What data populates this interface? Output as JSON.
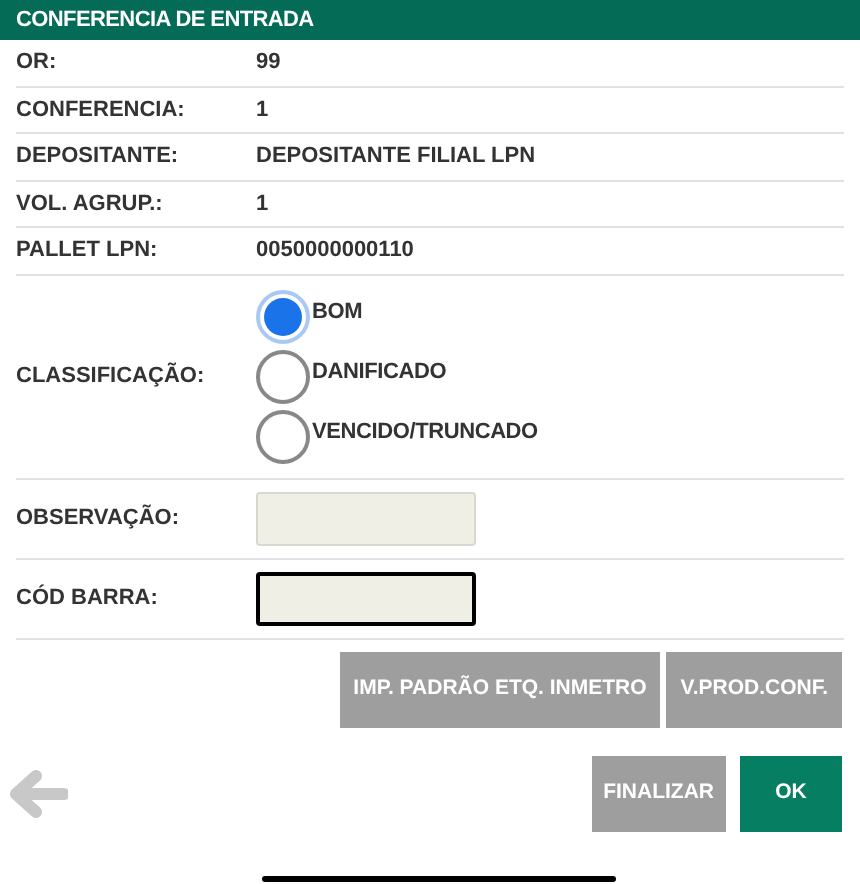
{
  "header": {
    "title": "CONFERENCIA DE ENTRADA"
  },
  "info_rows": [
    {
      "label": "OR:",
      "value": "99"
    },
    {
      "label": "CONFERENCIA:",
      "value": "1"
    },
    {
      "label": "DEPOSITANTE:",
      "value": "DEPOSITANTE FILIAL LPN"
    },
    {
      "label": "VOL. AGRUP.:",
      "value": "1"
    },
    {
      "label": "PALLET LPN:",
      "value": "0050000000110"
    }
  ],
  "classification": {
    "label": "CLASSIFICAÇÃO:",
    "options": [
      {
        "label": "BOM",
        "selected": true
      },
      {
        "label": "DANIFICADO",
        "selected": false
      },
      {
        "label": "VENCIDO/TRUNCADO",
        "selected": false
      }
    ]
  },
  "fields": [
    {
      "label": "OBSERVAÇÃO:",
      "focused": false
    },
    {
      "label": "CÓD BARRA:",
      "focused": true
    }
  ],
  "action_buttons": [
    {
      "label": "IMP. PADRÃO ETQ. INMETRO",
      "kind": "secondary"
    },
    {
      "label": "V.PROD.CONF.",
      "kind": "secondary"
    }
  ],
  "footer_buttons": [
    {
      "label": "FINALIZAR",
      "kind": "secondary"
    },
    {
      "label": "OK",
      "kind": "primary"
    }
  ]
}
